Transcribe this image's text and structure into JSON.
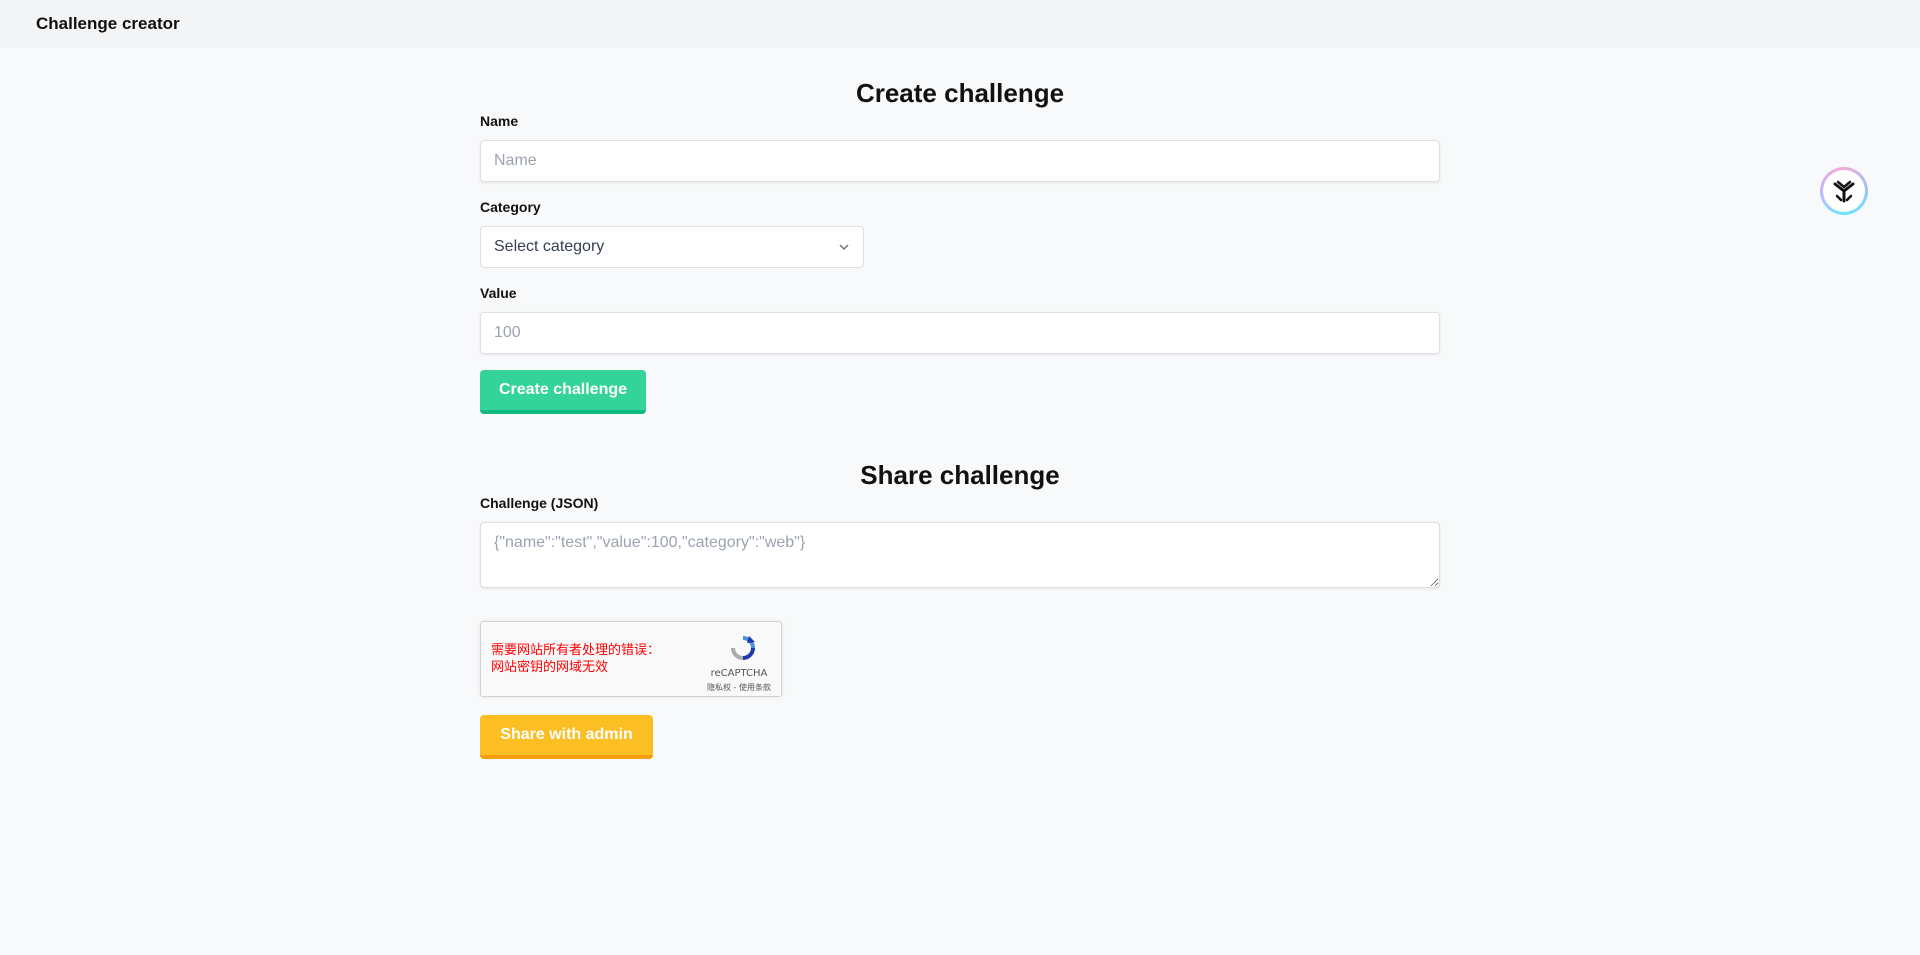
{
  "header": {
    "title": "Challenge creator"
  },
  "create": {
    "heading": "Create challenge",
    "name_label": "Name",
    "name_placeholder": "Name",
    "category_label": "Category",
    "category_selected": "Select category",
    "value_label": "Value",
    "value_placeholder": "100",
    "submit_label": "Create challenge"
  },
  "share": {
    "heading": "Share challenge",
    "json_label": "Challenge (JSON)",
    "json_placeholder": "{\"name\":\"test\",\"value\":100,\"category\":\"web\"}",
    "recaptcha": {
      "error_line1": "需要网站所有者处理的错误：",
      "error_line2": "网站密钥的网域无效",
      "brand": "reCAPTCHA",
      "links": "隐私权 - 使用条款"
    },
    "submit_label": "Share with admin"
  },
  "colors": {
    "create_button": "#34d399",
    "share_button": "#fbbf24",
    "error_text": "#ff0000"
  },
  "icons": {
    "floating": "assistant-logo-icon",
    "select": "chevron-down-icon",
    "recaptcha": "recaptcha-logo-icon"
  }
}
